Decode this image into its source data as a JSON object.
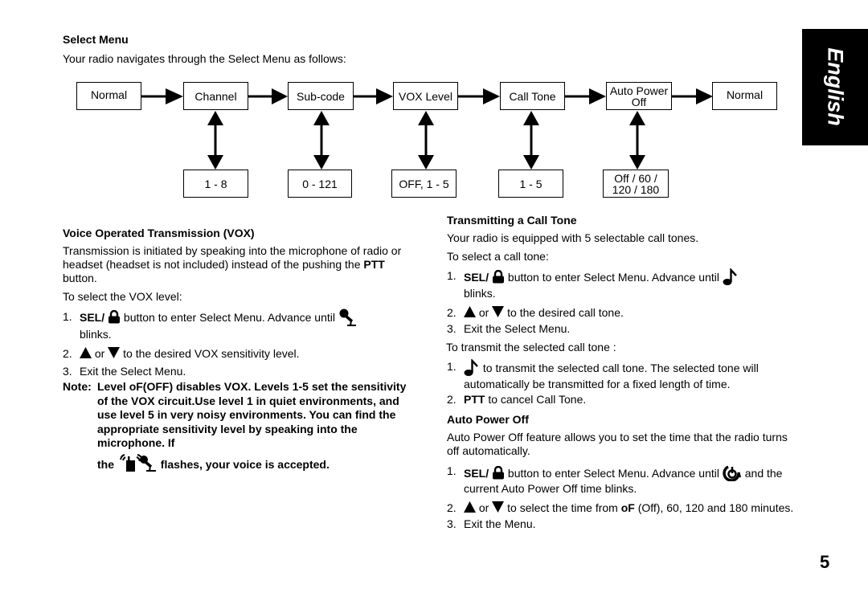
{
  "side_tab": {
    "label": "English"
  },
  "select_menu": {
    "title": "Select Menu",
    "intro": "Your radio navigates through the Select Menu as follows:",
    "flow": [
      {
        "label": "Normal",
        "option": null
      },
      {
        "label": "Channel",
        "option": "1 - 8"
      },
      {
        "label": "Sub-code",
        "option": "0 - 121"
      },
      {
        "label": "VOX Level",
        "option": "OFF, 1 - 5"
      },
      {
        "label": "Call Tone",
        "option": "1 - 5"
      },
      {
        "label_line1": "Auto Power",
        "label_line2": "Off",
        "option_line1": "Off / 60 /",
        "option_line2": "120 / 180"
      },
      {
        "label": "Normal",
        "option": null
      }
    ]
  },
  "vox": {
    "title": "Voice Operated Transmission (VOX)",
    "body_pre": "Transmission is initiated by speaking into the microphone of radio or headset (headset is not included) instead of the pushing the ",
    "body_bold": "PTT",
    "body_post": " button.",
    "sub": "To select the VOX level:",
    "steps": [
      {
        "num": "1.",
        "bold": "SEL/",
        "icon": "lock-icon",
        "text": "button to enter Select Menu. Advance until",
        "icon2": "vox-microphone-icon",
        "tail": "blinks."
      },
      {
        "num": "2.",
        "icon_up": "triangle-up-icon",
        "or": "or",
        "icon_down": "triangle-down-icon",
        "text": "to the desired VOX sensitivity level."
      },
      {
        "num": "3.",
        "text": "Exit the Select Menu."
      }
    ],
    "note_label": "Note:",
    "note_text": "Level oF(OFF) disables VOX. Levels 1-5 set the sensitivity of the VOX circuit.Use level 1 in quiet environments, and use level 5 in very noisy environments. You can find the appropriate sensitivity level by speaking into the microphone. If",
    "note_the": "the",
    "note_icon": "vox-transmit-icon",
    "note_tail": "flashes, your voice is accepted."
  },
  "call_tone": {
    "title": "Transmitting a Call Tone",
    "intro": "Your radio is equipped with 5 selectable call tones.",
    "sub": "To select a call tone:",
    "steps": [
      {
        "num": "1.",
        "bold": "SEL/",
        "icon": "lock-icon",
        "text": "button to enter Select Menu. Advance until",
        "icon2": "music-note-icon",
        "tail": "blinks."
      },
      {
        "num": "2.",
        "or": "or",
        "text": "to the desired call tone."
      },
      {
        "num": "3.",
        "text": "Exit the Select Menu."
      }
    ],
    "sub2": "To transmit the selected call tone :",
    "steps2": [
      {
        "num": "1.",
        "icon": "music-note-icon",
        "text": "to transmit the selected call tone. The selected tone will automatically be transmitted for a fixed length of time."
      },
      {
        "num": "2.",
        "bold": "PTT",
        "text": " to cancel Call Tone."
      }
    ]
  },
  "auto_power": {
    "title": "Auto Power Off",
    "intro": "Auto Power Off feature allows you to set the time that the radio turns off automatically.",
    "steps": [
      {
        "num": "1.",
        "bold": "SEL/",
        "icon": "lock-icon",
        "text": "button to enter Select Menu. Advance until",
        "icon2": "power-timer-icon",
        "tail": "and the current Auto Power Off time blinks."
      },
      {
        "num": "2.",
        "or": "or",
        "text_pre": "to select the time from ",
        "bold": "oF",
        "text_post": " (Off), 60, 120 and 180 minutes."
      },
      {
        "num": "3.",
        "text": "Exit the Menu."
      }
    ]
  },
  "page_number": "5"
}
